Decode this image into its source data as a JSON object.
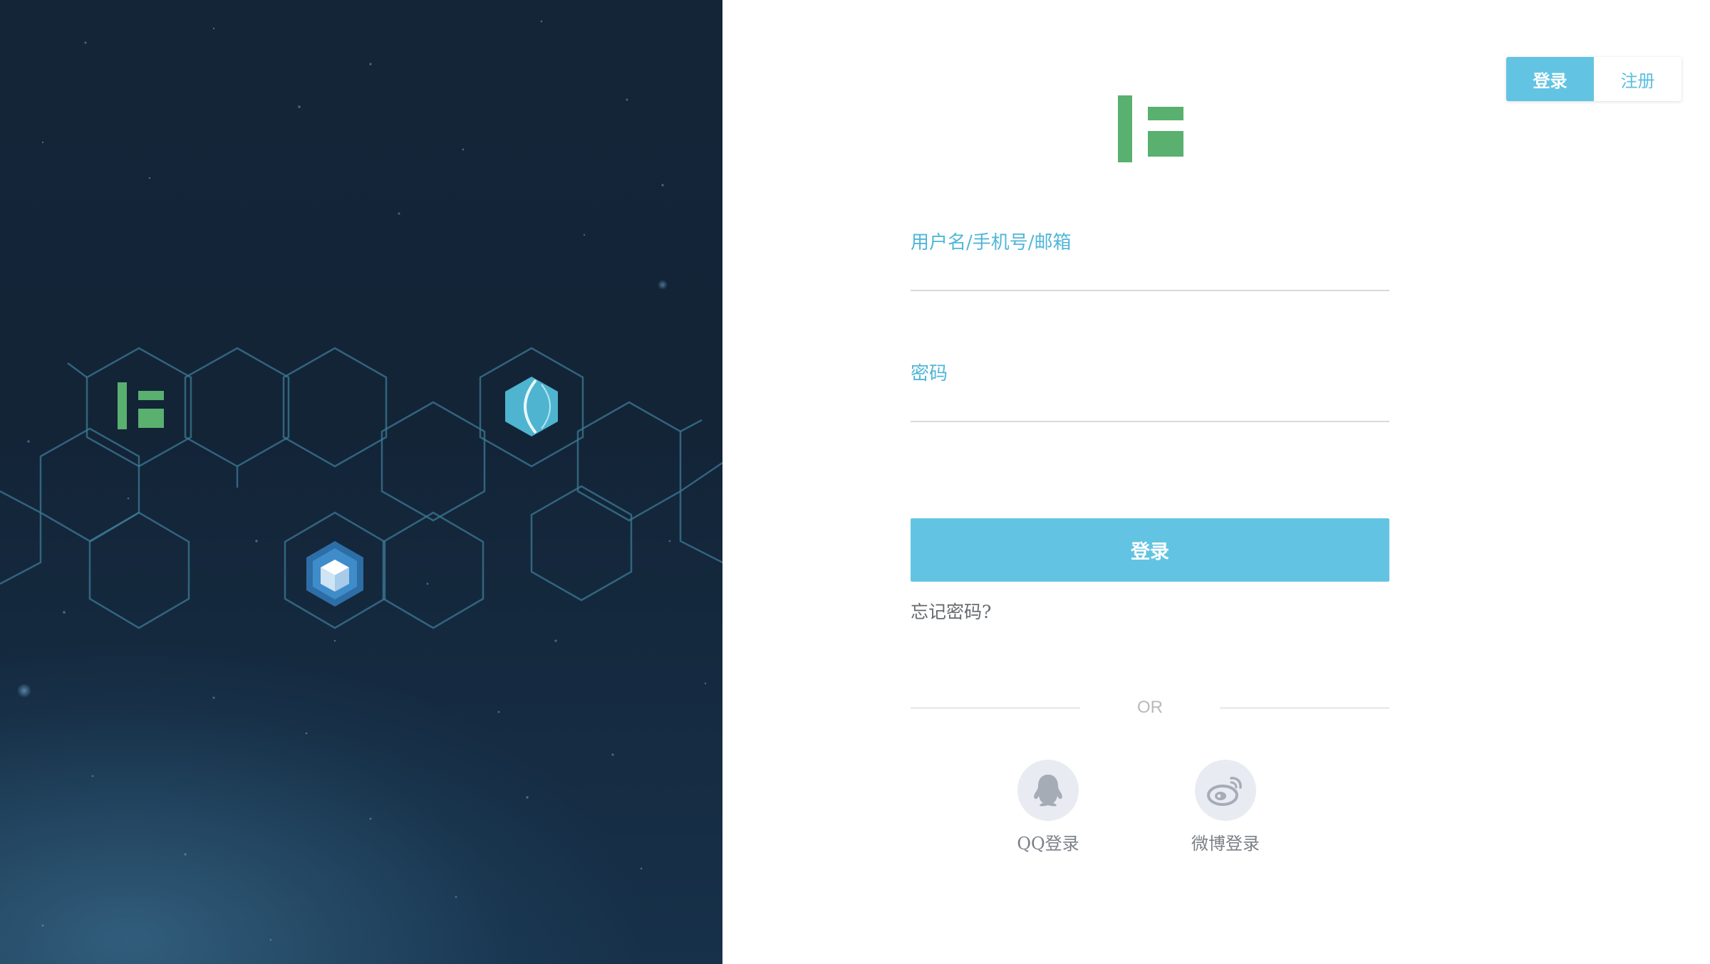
{
  "header": {
    "tabs": [
      {
        "label": "登录",
        "active": true
      },
      {
        "label": "注册",
        "active": false
      }
    ]
  },
  "login_form": {
    "username_label": "用户名/手机号/邮箱",
    "username_value": "",
    "password_label": "密码",
    "password_value": "",
    "submit_label": "登录",
    "forgot_label": "忘记密码?"
  },
  "divider": {
    "text": "OR"
  },
  "social": [
    {
      "label": "QQ登录",
      "icon": "qq-penguin-icon"
    },
    {
      "label": "微博登录",
      "icon": "weibo-icon"
    }
  ],
  "colors": {
    "accent": "#62c4e2",
    "brand_green": "#59b06f",
    "background_dark": "#132437"
  },
  "illustration": {
    "icons": [
      "brand-logo-icon",
      "hex-lens-icon",
      "cube-icon"
    ]
  }
}
